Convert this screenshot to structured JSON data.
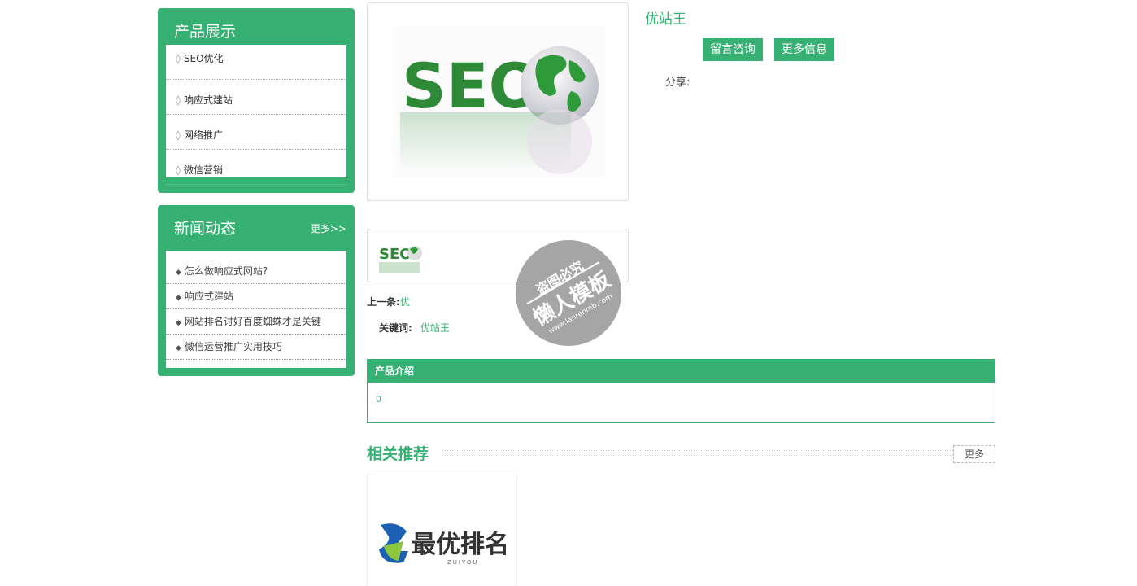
{
  "sidebar": {
    "products": {
      "title": "产品展示",
      "bullet": "◊",
      "items": [
        {
          "label": "SEO优化"
        },
        {
          "label": "响应式建站"
        },
        {
          "label": "网络推广"
        },
        {
          "label": "微信营销"
        }
      ]
    },
    "news": {
      "title": "新闻动态",
      "more": "更多>>",
      "bullet": "◆",
      "items": [
        {
          "label": "怎么做响应式网站?"
        },
        {
          "label": "响应式建站"
        },
        {
          "label": "网站排名讨好百度蜘蛛才是关键"
        },
        {
          "label": "微信运营推广实用技巧"
        }
      ]
    }
  },
  "product": {
    "name": "优站王",
    "consult_button": "留言咨询",
    "more_button": "更多信息",
    "share_label": "分享:",
    "prev_label": "上一条:",
    "prev_link": "优",
    "keywords_label": "关键词:",
    "keywords_value": "优站王",
    "image_text": "SEO"
  },
  "intro": {
    "title": "产品介绍",
    "body": "0"
  },
  "related": {
    "title": "相关推荐",
    "more": "更多",
    "card_logo_text": "最优排名",
    "card_logo_sub": "ZUIYOU"
  },
  "watermark": {
    "line1": "盗图必究",
    "line2": "懒人模板",
    "line3": "www.lanrenmb.com"
  },
  "colors": {
    "brand": "#36b073"
  }
}
